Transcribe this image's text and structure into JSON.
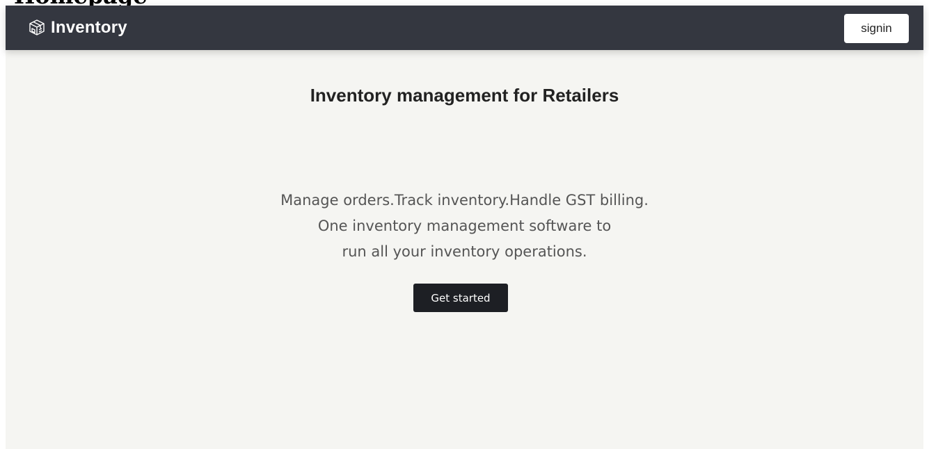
{
  "doc_heading": "Homepage",
  "navbar": {
    "brand_icon": "boxes-icon",
    "brand_name": "Inventory",
    "signin_label": "signin"
  },
  "hero": {
    "headline": "Inventory management for Retailers",
    "tagline_lines": [
      "Manage orders.Track inventory.Handle GST billing.",
      "One inventory management software to",
      "run all your inventory operations."
    ],
    "cta_label": "Get started"
  },
  "colors": {
    "navbar_bg": "#343740",
    "page_bg": "#f5f5f2",
    "cta_bg": "#1d1f24"
  }
}
